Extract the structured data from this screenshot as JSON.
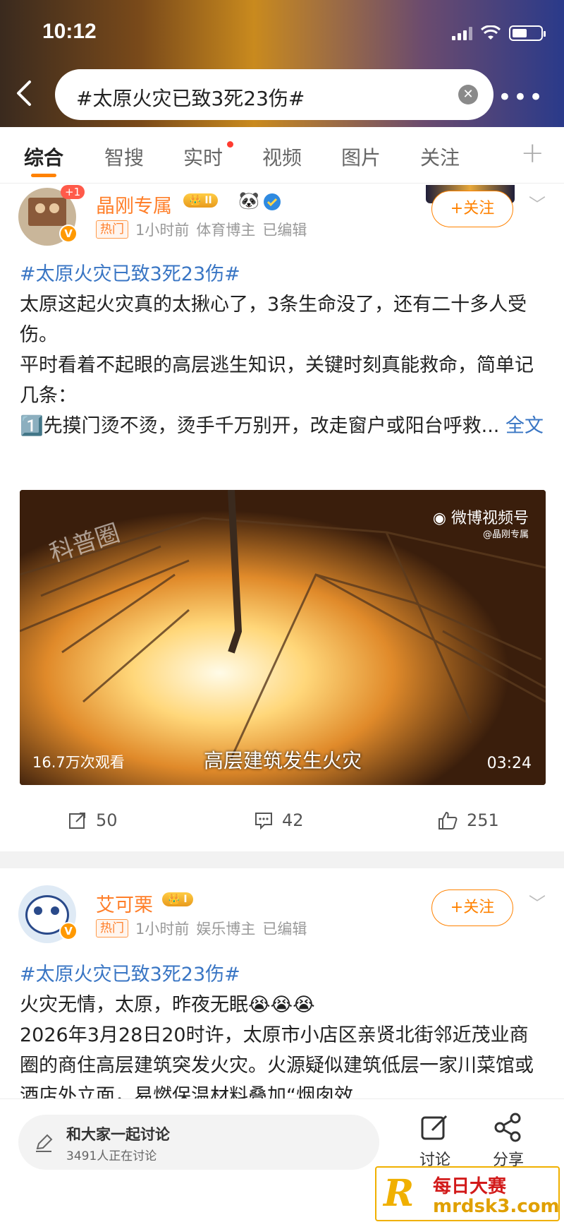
{
  "status": {
    "time": "10:12"
  },
  "search": {
    "query": "#太原火灾已致3死23伤#"
  },
  "tabs": [
    {
      "label": "综合"
    },
    {
      "label": "智搜"
    },
    {
      "label": "实时"
    },
    {
      "label": "视频"
    },
    {
      "label": "图片"
    },
    {
      "label": "关注"
    }
  ],
  "posts": [
    {
      "username": "晶刚专属",
      "vip_level": "II",
      "avatar_badge": "+1",
      "hot_tag": "热门",
      "time": "1小时前",
      "category": "体育博主",
      "edited": "已编辑",
      "follow_label": "+关注",
      "hashtag": "#太原火灾已致3死23伤#",
      "text_lines": [
        "太原这起火灾真的太揪心了，3条生命没了，还有二十多人受伤。",
        "平时看着不起眼的高层逃生知识，关键时刻真能救命，简单记几条：",
        "1️⃣先摸门烫不烫，烫手千万别开，改走窗户或阳台呼救..."
      ],
      "more_link": "全文",
      "video": {
        "views": "16.7万次观看",
        "caption": "高层建筑发生火灾",
        "duration": "03:24",
        "channel": "微博视频号",
        "channel_handle": "@晶刚专属",
        "watermark": "科普圈"
      },
      "reposts": "50",
      "comments": "42",
      "likes": "251"
    },
    {
      "username": "艾可栗",
      "vip_level": "I",
      "hot_tag": "热门",
      "time": "1小时前",
      "category": "娱乐博主",
      "edited": "已编辑",
      "follow_label": "+关注",
      "hashtag": "#太原火灾已致3死23伤#",
      "text_lines": [
        "火灾无情，太原，昨夜无眠😭😭😭",
        "2026年3月28日20时许，太原市小店区亲贤北街邻近茂业商圈的商住高层建筑突发火灾。火源疑似建筑低层一家川菜馆或酒店外立面，易燃保温材料叠加“烟囱效"
      ]
    }
  ],
  "bottom": {
    "discuss_title": "和大家一起讨论",
    "discuss_count": "3491人正在讨论",
    "discuss_action": "讨论",
    "share_action": "分享"
  },
  "watermark": {
    "title": "每日大赛",
    "url": "mrdsk3.com",
    "logo": "R"
  }
}
